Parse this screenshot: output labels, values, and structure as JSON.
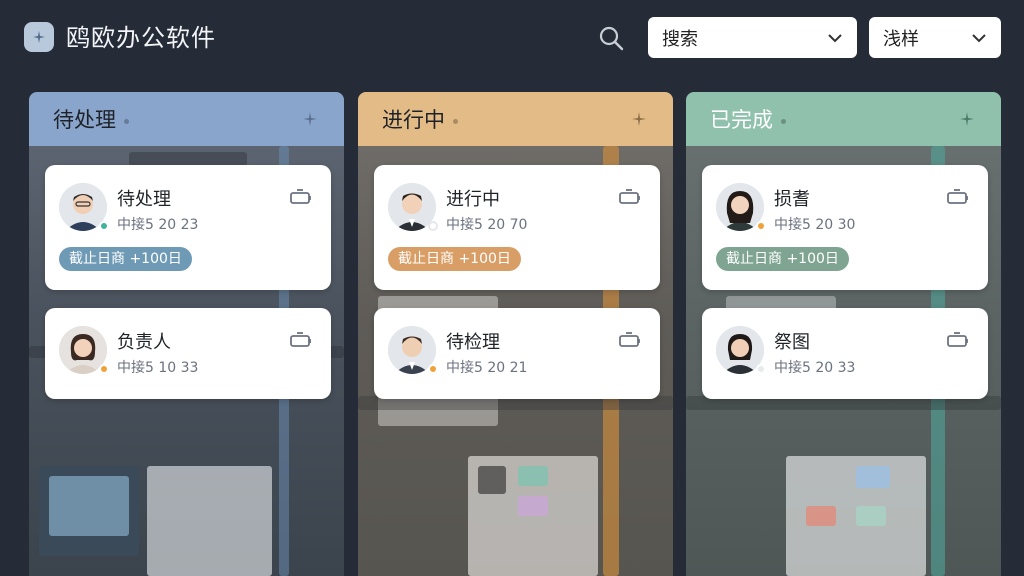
{
  "app": {
    "title": "鸥欧办公软件"
  },
  "toolbar": {
    "search_select": "搜索",
    "style_select": "浅样"
  },
  "colors": {
    "todo": "#8aa5cc",
    "doing": "#e2bb86",
    "done": "#8fc1ad"
  },
  "columns": [
    {
      "title": "待处理",
      "cards": [
        {
          "title": "待处理",
          "meta": "中接5 20 23",
          "tag": "截止日商 +100日",
          "status_color": "#3fb39b"
        },
        {
          "title": "负责人",
          "meta": "中接5 10 33",
          "status_color": "#f0a23a"
        }
      ]
    },
    {
      "title": "进行中",
      "cards": [
        {
          "title": "进行中",
          "meta": "中接5 20 70",
          "tag": "截止日商 +100日",
          "status_color": "#ffffff"
        },
        {
          "title": "待检理",
          "meta": "中接5 20 21",
          "status_color": "#f0a23a"
        }
      ]
    },
    {
      "title": "已完成",
      "cards": [
        {
          "title": "损耆",
          "meta": "中接5 20 30",
          "tag": "截止日商 +100日",
          "status_color": "#f0a23a"
        },
        {
          "title": "祭图",
          "meta": "中接5 20 33",
          "status_color": "#e8eaed"
        }
      ]
    }
  ]
}
